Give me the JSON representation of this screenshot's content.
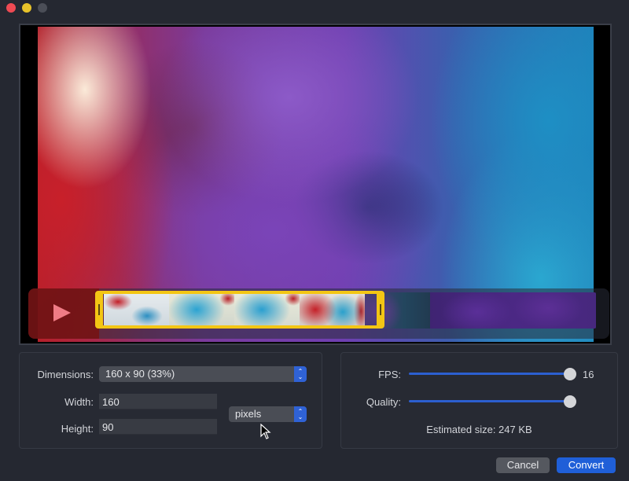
{
  "window": {
    "controls": [
      "close",
      "minimize",
      "maximize"
    ]
  },
  "preview": {
    "play_icon": "play-icon",
    "selection": {
      "start_fraction": 0.0,
      "end_fraction": 0.57
    }
  },
  "dimensions_panel": {
    "dimensions_label": "Dimensions:",
    "dimensions_value": "160 x 90 (33%)",
    "width_label": "Width:",
    "width_value": "160",
    "height_label": "Height:",
    "height_value": "90",
    "units_value": "pixels"
  },
  "output_panel": {
    "fps_label": "FPS:",
    "fps_value": "16",
    "fps_fraction": 1.0,
    "quality_label": "Quality:",
    "quality_fraction": 1.0,
    "estimated_size": "Estimated size: 247 KB"
  },
  "buttons": {
    "cancel": "Cancel",
    "convert": "Convert"
  },
  "colors": {
    "accent": "#2f62d6",
    "selection": "#f3c614",
    "close": "#ee4a53",
    "minimize": "#e8c32a"
  }
}
